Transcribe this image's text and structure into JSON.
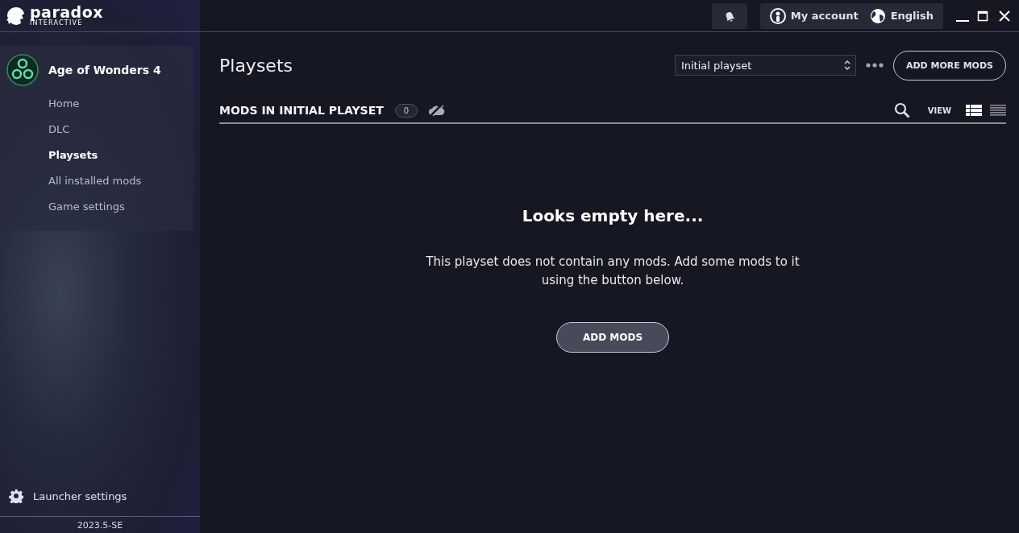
{
  "logo": {
    "name": "paradox",
    "tagline": "INTERACTIVE"
  },
  "sidebar": {
    "game": {
      "title": "Age of Wonders 4"
    },
    "items": [
      {
        "label": "Home",
        "selected": false
      },
      {
        "label": "DLC",
        "selected": false
      },
      {
        "label": "Playsets",
        "selected": true
      },
      {
        "label": "All installed mods",
        "selected": false
      },
      {
        "label": "Game settings",
        "selected": false
      }
    ],
    "launcher_settings": "Launcher settings",
    "version": "2023.5-SE"
  },
  "topbar": {
    "account": "My account",
    "language": "English"
  },
  "page": {
    "title": "Playsets",
    "playset_select": {
      "value": "Initial playset"
    },
    "add_more_button": "ADD MORE MODS",
    "section_title": "MODS IN INITIAL PLAYSET",
    "count": "0",
    "view_label": "VIEW",
    "view_modes": [
      {
        "kind": "table",
        "selected": true
      },
      {
        "kind": "list",
        "selected": false
      }
    ],
    "empty": {
      "heading": "Looks empty here...",
      "message": "This playset does not contain any mods. Add some mods to it using the button below.",
      "button": "ADD MODS"
    }
  }
}
